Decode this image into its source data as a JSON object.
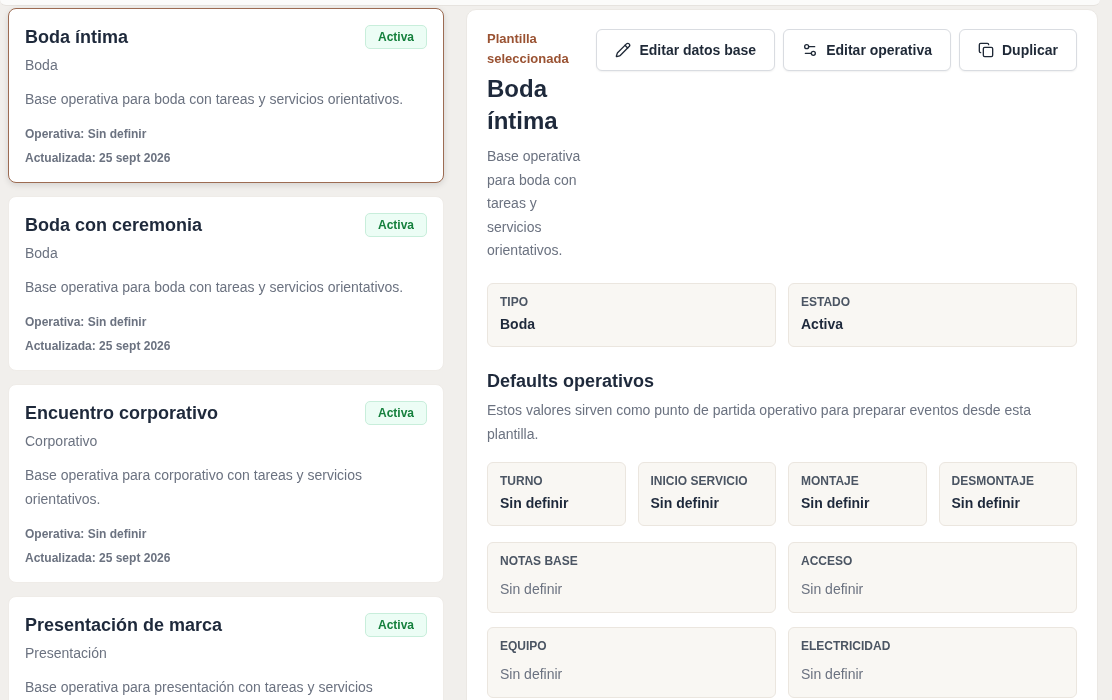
{
  "templates": [
    {
      "name": "Boda íntima",
      "status": "Activa",
      "type": "Boda",
      "description": "Base operativa para boda con tareas y servicios orientativos.",
      "operational": "Operativa: Sin definir",
      "updated": "Actualizada: 25 sept 2026",
      "selected": true
    },
    {
      "name": "Boda con ceremonia",
      "status": "Activa",
      "type": "Boda",
      "description": "Base operativa para boda con tareas y servicios orientativos.",
      "operational": "Operativa: Sin definir",
      "updated": "Actualizada: 25 sept 2026",
      "selected": false
    },
    {
      "name": "Encuentro corporativo",
      "status": "Activa",
      "type": "Corporativo",
      "description": "Base operativa para corporativo con tareas y servicios orientativos.",
      "operational": "Operativa: Sin definir",
      "updated": "Actualizada: 25 sept 2026",
      "selected": false
    },
    {
      "name": "Presentación de marca",
      "status": "Activa",
      "type": "Presentación",
      "description": "Base operativa para presentación con tareas y servicios",
      "selected": false
    }
  ],
  "detail": {
    "eyebrow": "Plantilla seleccionada",
    "title": "Boda íntima",
    "description": "Base operativa para boda con tareas y servicios orientativos.",
    "actions": [
      {
        "kind": "edit",
        "label": "Editar datos base"
      },
      {
        "kind": "settings",
        "label": "Editar operativa"
      },
      {
        "kind": "duplicate",
        "label": "Duplicar"
      }
    ],
    "summary": [
      {
        "label": "TIPO",
        "value": "Boda"
      },
      {
        "label": "ESTADO",
        "value": "Activa"
      }
    ],
    "defaults": {
      "title": "Defaults operativos",
      "description": "Estos valores sirven como punto de partida operativo para preparar eventos desde esta plantilla.",
      "schedule": [
        {
          "label": "TURNO",
          "value": "Sin definir"
        },
        {
          "label": "INICIO SERVICIO",
          "value": "Sin definir"
        },
        {
          "label": "MONTAJE",
          "value": "Sin definir"
        },
        {
          "label": "DESMONTAJE",
          "value": "Sin definir"
        }
      ],
      "notes": [
        {
          "label": "NOTAS BASE",
          "value": "Sin definir"
        },
        {
          "label": "ACCESO",
          "value": "Sin definir"
        },
        {
          "label": "EQUIPO",
          "value": "Sin definir"
        },
        {
          "label": "ELECTRICIDAD",
          "value": "Sin definir"
        }
      ]
    }
  }
}
